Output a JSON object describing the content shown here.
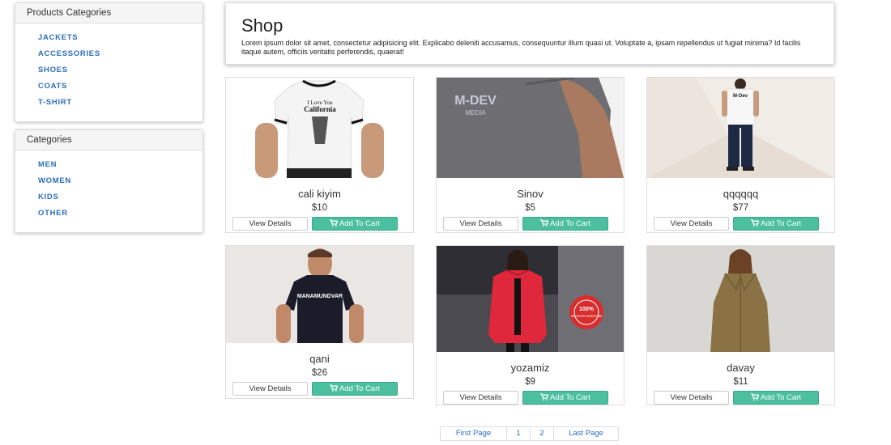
{
  "sidebar": {
    "product_categories": {
      "title": "Products Categories",
      "items": [
        "JACKETS",
        "ACCESSORIES",
        "SHOES",
        "COATS",
        "T-SHIRT"
      ]
    },
    "categories": {
      "title": "Categories",
      "items": [
        "MEN",
        "WOMEN",
        "KIDS",
        "OTHER"
      ]
    }
  },
  "header": {
    "title": "Shop",
    "description": "Lorem ipsum dolor sit amet, consectetur adipisicing elit. Explicabo deleniti accusamus, consequuntur illum quasi ut. Voluptate a, ipsam repellendus ut fugiat minima? Id facilis itaque autem, officiis veritatis perferendis, quaerat!"
  },
  "products": [
    {
      "name": "cali kiyim",
      "price": "$10",
      "image": "white-tshirt-photo"
    },
    {
      "name": "Sinov",
      "price": "$5",
      "image": "grey-tshirt-photo"
    },
    {
      "name": "qqqqqq",
      "price": "$77",
      "image": "man-back-photo"
    },
    {
      "name": "qani",
      "price": "$26",
      "image": "black-tshirt-photo"
    },
    {
      "name": "yozamiz",
      "price": "$9",
      "image": "red-jacket-photo"
    },
    {
      "name": "davay",
      "price": "$11",
      "image": "olive-coat-photo"
    }
  ],
  "buttons": {
    "view_details": "View Details",
    "add_to_cart": "Add To Cart"
  },
  "pagination": {
    "first": "First Page",
    "pages": [
      "1",
      "2"
    ],
    "last": "Last Page"
  },
  "image_text": {
    "shirt1_line1": "I Love You",
    "shirt1_line2": "California",
    "shirt2": "M-DEV",
    "shirt2_sub": "MEDIA",
    "shirt3": "M-Dev",
    "shirt4": "MANAMUNDVAR",
    "jacket_badge_big": "100%",
    "jacket_badge_ring": "DESIGNER WARDROBE"
  },
  "colors": {
    "link": "#2a6ebb",
    "cart_button": "#4bbf9f",
    "panel_heading_bg": "#f5f5f5"
  }
}
